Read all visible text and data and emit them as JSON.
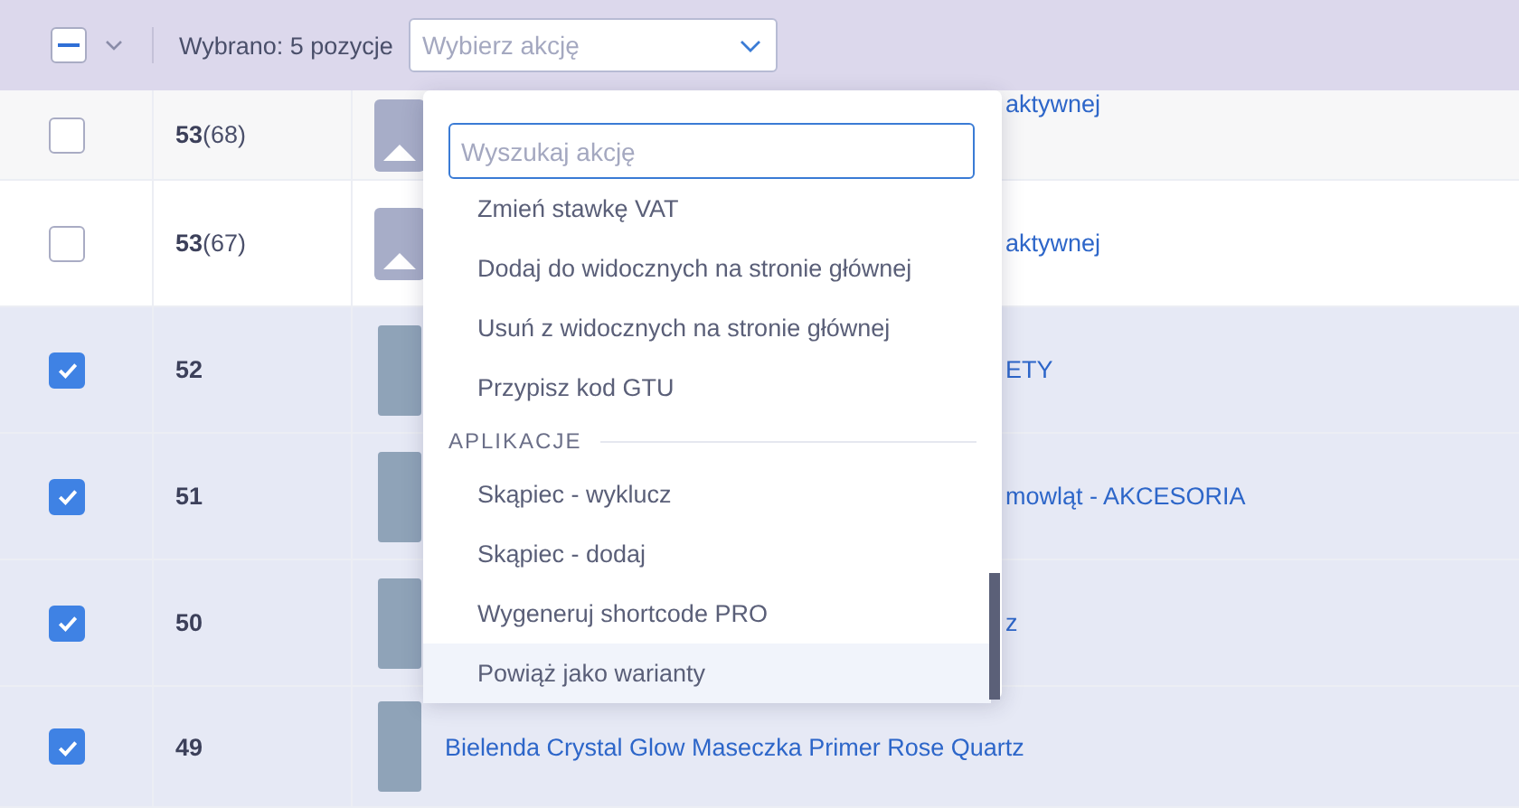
{
  "toolbar": {
    "select_all": {
      "indeterminate": true
    },
    "selected_count": "Wybrano: 5 pozycje",
    "action_select": {
      "placeholder": "Wybierz akcję"
    }
  },
  "rows": [
    {
      "checked": false,
      "id": "53",
      "sub_id": "(68)",
      "kind": "placeholder",
      "name": "aktywnej",
      "covered": true
    },
    {
      "checked": false,
      "id": "53",
      "sub_id": "(67)",
      "kind": "placeholder",
      "name": "aktywnej",
      "covered": true
    },
    {
      "checked": true,
      "id": "52",
      "kind": "photo",
      "name": "ETY",
      "covered": true
    },
    {
      "checked": true,
      "id": "51",
      "kind": "photo",
      "name": "mowląt - AKCESORIA",
      "covered": true
    },
    {
      "checked": true,
      "id": "50",
      "kind": "photo",
      "name": "z",
      "covered": true
    },
    {
      "checked": true,
      "id": "49",
      "kind": "photo",
      "name": "Bielenda Crystal Glow Maseczka Primer Rose Quartz",
      "covered": false
    }
  ],
  "dropdown": {
    "search": {
      "placeholder": "Wyszukaj akcję"
    },
    "items": [
      {
        "kind": "action",
        "label": "Zmień stawkę VAT",
        "selected": false
      },
      {
        "kind": "action",
        "label": "Dodaj do widocznych na stronie głównej",
        "selected": false
      },
      {
        "kind": "action",
        "label": "Usuń z widocznych na stronie głównej",
        "selected": false
      },
      {
        "kind": "action",
        "label": "Przypisz kod GTU",
        "selected": false
      },
      {
        "kind": "header",
        "label": "APLIKACJE"
      },
      {
        "kind": "action",
        "label": "Skąpiec - wyklucz",
        "selected": false
      },
      {
        "kind": "action",
        "label": "Skąpiec - dodaj",
        "selected": false
      },
      {
        "kind": "action",
        "label": "Wygeneruj shortcode PRO",
        "selected": false
      },
      {
        "kind": "action",
        "label": "Powiąż jako warianty",
        "selected": true
      }
    ]
  }
}
